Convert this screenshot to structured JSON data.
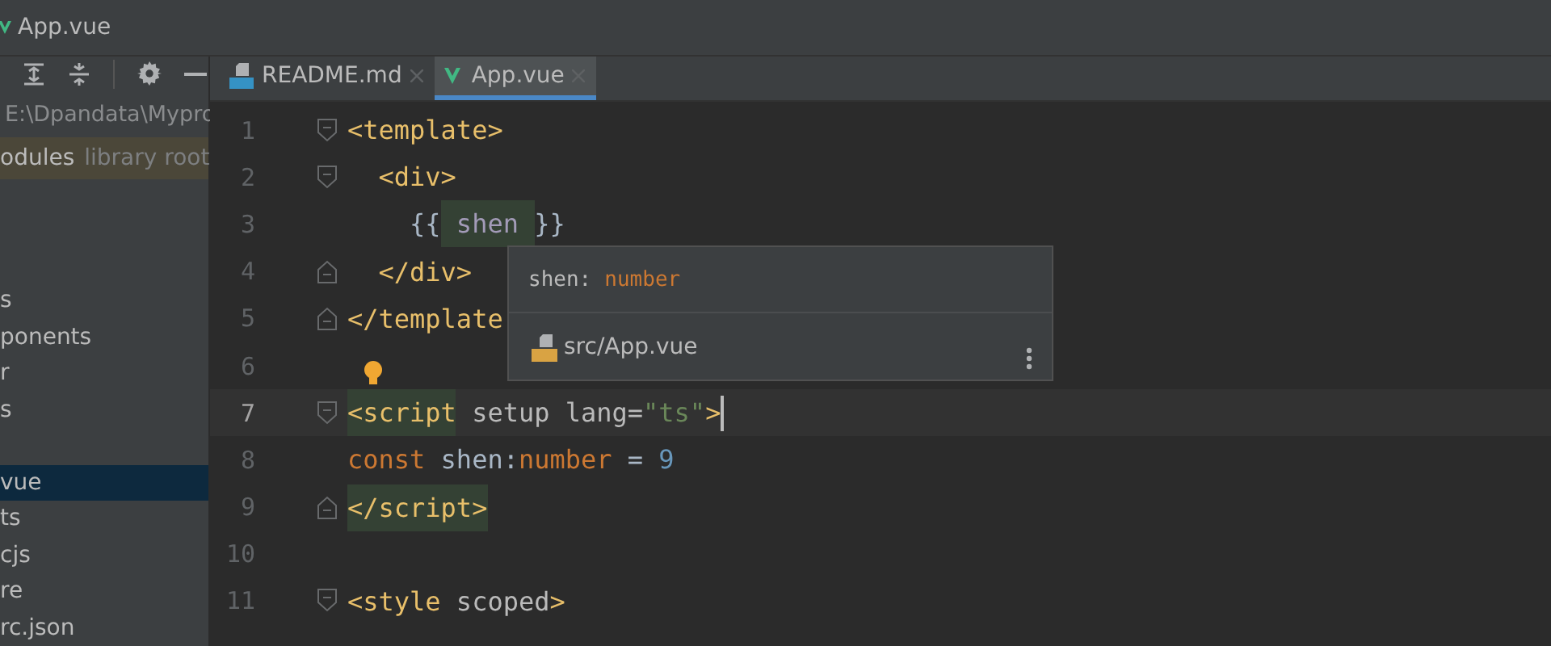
{
  "window": {
    "title": "App.vue"
  },
  "sidebar": {
    "path": "E:\\Dpandata\\Mypro",
    "items": [
      {
        "label": "odules",
        "hint": "library root",
        "selected": false,
        "highlighted": true
      },
      {
        "label": "s",
        "selected": false,
        "highlighted": false,
        "gap_before": true
      },
      {
        "label": "ponents",
        "selected": false,
        "highlighted": false
      },
      {
        "label": "r",
        "selected": false,
        "highlighted": false
      },
      {
        "label": "s",
        "selected": false,
        "highlighted": false
      },
      {
        "label": "vue",
        "selected": true,
        "highlighted": false,
        "gap_before": true
      },
      {
        "label": "ts",
        "selected": false,
        "highlighted": false
      },
      {
        "label": "cjs",
        "selected": false,
        "highlighted": false
      },
      {
        "label": "re",
        "selected": false,
        "highlighted": false
      },
      {
        "label": "rc.json",
        "selected": false,
        "highlighted": false
      }
    ]
  },
  "tabs": [
    {
      "label": "README.md",
      "kind": "markdown",
      "selected": false
    },
    {
      "label": "App.vue",
      "kind": "vue",
      "selected": true
    }
  ],
  "editor": {
    "lines": [
      {
        "number": "1",
        "fold_start": true,
        "current": false,
        "tokens": [
          {
            "text": "<template>",
            "kind": "tag",
            "highlighted": false
          }
        ]
      },
      {
        "number": "2",
        "fold_start": true,
        "current": false,
        "tokens": [
          {
            "text": "  <div>",
            "kind": "tag",
            "highlighted": false
          }
        ]
      },
      {
        "number": "3",
        "current": false,
        "tokens": [
          {
            "text": "    {{",
            "kind": "brace",
            "highlighted": false
          },
          {
            "text": " shen ",
            "kind": "interp",
            "highlighted": true
          },
          {
            "text": "}}",
            "kind": "brace",
            "highlighted": false
          }
        ]
      },
      {
        "number": "4",
        "fold_end": true,
        "current": false,
        "tokens": [
          {
            "text": "  </div>",
            "kind": "tag",
            "highlighted": false
          }
        ]
      },
      {
        "number": "5",
        "fold_end": true,
        "current": false,
        "tokens": [
          {
            "text": "</template",
            "kind": "tag",
            "highlighted": false
          }
        ]
      },
      {
        "number": "6",
        "current": false,
        "bulb": true
      },
      {
        "number": "7",
        "fold_start": true,
        "current": true,
        "tokens": [
          {
            "text": "<script",
            "kind": "tag",
            "highlighted": true
          },
          {
            "text": " setup lang=",
            "kind": "attr",
            "highlighted": false
          },
          {
            "text": "\"ts\"",
            "kind": "string",
            "highlighted": false
          },
          {
            "text": ">",
            "kind": "tag",
            "highlighted": false
          }
        ]
      },
      {
        "number": "8",
        "current": false,
        "tokens": [
          {
            "text": "const ",
            "kind": "keyword",
            "highlighted": false
          },
          {
            "text": "shen:",
            "kind": "plain",
            "highlighted": false
          },
          {
            "text": "number",
            "kind": "keyword",
            "highlighted": false
          },
          {
            "text": " = ",
            "kind": "plain",
            "highlighted": false
          },
          {
            "text": "9",
            "kind": "number",
            "highlighted": false
          }
        ]
      },
      {
        "number": "9",
        "fold_end": true,
        "current": false,
        "tokens": [
          {
            "text": "</script>",
            "kind": "tag",
            "highlighted": true
          }
        ]
      },
      {
        "number": "10",
        "current": false
      },
      {
        "number": "11",
        "fold_start": true,
        "current": false,
        "tokens": [
          {
            "text": "<style",
            "kind": "tag",
            "highlighted": false
          },
          {
            "text": " scoped",
            "kind": "attr",
            "highlighted": false
          },
          {
            "text": ">",
            "kind": "tag",
            "highlighted": false
          }
        ]
      }
    ]
  },
  "popup": {
    "name": "shen:",
    "type": "number",
    "file": "src/App.vue"
  }
}
